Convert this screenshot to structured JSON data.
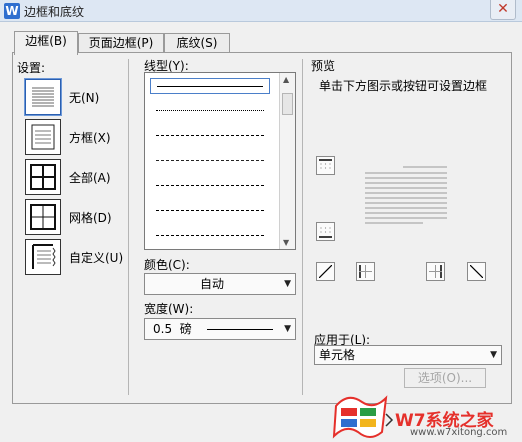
{
  "window": {
    "app_icon": "W",
    "title": "边框和底纹",
    "close": "✕"
  },
  "tabs": [
    {
      "label": "边框(B)",
      "active": true
    },
    {
      "label": "页面边框(P)",
      "active": false
    },
    {
      "label": "底纹(S)",
      "active": false
    }
  ],
  "settings": {
    "heading": "设置:",
    "items": [
      {
        "label": "无(N)",
        "selected": true
      },
      {
        "label": "方框(X)",
        "selected": false
      },
      {
        "label": "全部(A)",
        "selected": false
      },
      {
        "label": "网格(D)",
        "selected": false
      },
      {
        "label": "自定义(U)",
        "selected": false
      }
    ]
  },
  "line_style": {
    "heading": "线型(Y):",
    "styles": [
      "solid",
      "dotted",
      "small-dash",
      "dash",
      "dash-dot",
      "long-dash",
      "dash-dot-dot"
    ]
  },
  "color": {
    "heading": "颜色(C):",
    "value": "自动"
  },
  "width": {
    "heading": "宽度(W):",
    "value": "0.5  磅"
  },
  "preview": {
    "heading": "预览",
    "hint": "单击下方图示或按钮可设置边框"
  },
  "apply_to": {
    "heading": "应用于(L):",
    "value": "单元格"
  },
  "options_button": "选项(O)...",
  "watermark": {
    "text": "W7系统之家",
    "url": "www.w7xitong.com"
  },
  "colors": {
    "accent": "#2f6fcf",
    "watermark_red": "#e5302b"
  }
}
